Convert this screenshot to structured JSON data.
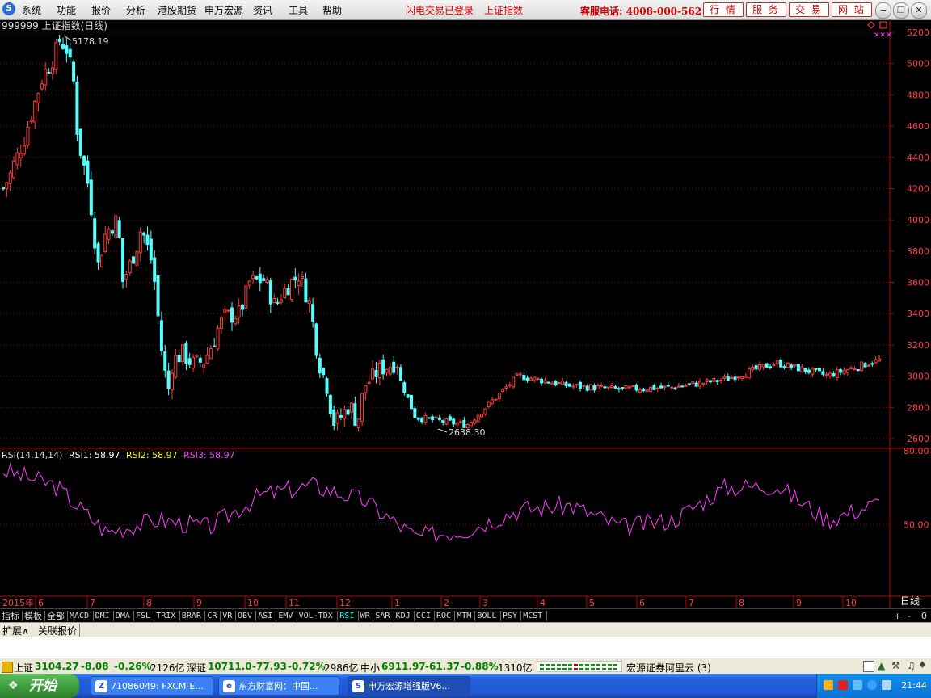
{
  "menu": {
    "items": [
      "系统",
      "功能",
      "报价",
      "分析",
      "港股期货",
      "申万宏源",
      "资讯",
      "工具",
      "帮助"
    ],
    "status_login": "闪电交易已登录",
    "status_index": "上证指数",
    "hotline": "客服电话: 4008-000-562",
    "right_buttons": [
      "行 情",
      "服 务",
      "交 易",
      "网 站"
    ]
  },
  "chart_data": [
    {
      "type": "candlestick",
      "title": "999999 上证指数(日线)",
      "max_label": "5178.19",
      "min_label": "2638.30",
      "ylim": [
        2560,
        5260
      ],
      "y_ticks": [
        "5200",
        "5000",
        "4800",
        "4600",
        "4400",
        "4200",
        "4000",
        "3800",
        "3600",
        "3400",
        "3200",
        "3000",
        "2800",
        "2600"
      ],
      "x_labels": [
        "2015年",
        "6",
        "7",
        "8",
        "9",
        "10",
        "11",
        "12",
        "1",
        "2",
        "3",
        "4",
        "5",
        "6",
        "7",
        "8",
        "9",
        "10"
      ],
      "period_label": "日线",
      "colors": {
        "up": "#ff3c3c",
        "down": "#54ffff"
      },
      "closes_monthly_approx": [
        {
          "month": "2015-05",
          "close": 4612
        },
        {
          "month": "2015-06",
          "close": 4277
        },
        {
          "month": "2015-07",
          "close": 3663
        },
        {
          "month": "2015-08",
          "close": 3206
        },
        {
          "month": "2015-09",
          "close": 3053
        },
        {
          "month": "2015-10",
          "close": 3382
        },
        {
          "month": "2015-11",
          "close": 3445
        },
        {
          "month": "2015-12",
          "close": 3539
        },
        {
          "month": "2016-01",
          "close": 2737
        },
        {
          "month": "2016-02",
          "close": 2688
        },
        {
          "month": "2016-03",
          "close": 3003
        },
        {
          "month": "2016-04",
          "close": 2938
        },
        {
          "month": "2016-05",
          "close": 2916
        },
        {
          "month": "2016-06",
          "close": 2929
        },
        {
          "month": "2016-07",
          "close": 2979
        },
        {
          "month": "2016-08",
          "close": 3085
        },
        {
          "month": "2016-09",
          "close": 3004
        },
        {
          "month": "2016-10",
          "close": 3104
        }
      ]
    },
    {
      "type": "line",
      "title": "RSI(14,14,14)",
      "series": [
        {
          "name": "RSI1",
          "value": "58.97",
          "color": "#ffffff"
        },
        {
          "name": "RSI2",
          "value": "58.97",
          "color": "#ffff00"
        },
        {
          "name": "RSI3",
          "value": "58.97",
          "color": "#ff40ff"
        }
      ],
      "ylim": [
        42,
        80
      ],
      "y_ticks": [
        "80.00",
        "50.00"
      ],
      "values_monthly_approx": [
        {
          "month": "2015-05",
          "value": 72
        },
        {
          "month": "2015-06",
          "value": 66
        },
        {
          "month": "2015-07",
          "value": 47
        },
        {
          "month": "2015-08",
          "value": 52
        },
        {
          "month": "2015-09",
          "value": 49
        },
        {
          "month": "2015-10",
          "value": 62
        },
        {
          "month": "2015-11",
          "value": 66
        },
        {
          "month": "2015-12",
          "value": 60
        },
        {
          "month": "2016-01",
          "value": 45
        },
        {
          "month": "2016-02",
          "value": 48
        },
        {
          "month": "2016-03",
          "value": 56
        },
        {
          "month": "2016-04",
          "value": 58
        },
        {
          "month": "2016-05",
          "value": 49
        },
        {
          "month": "2016-06",
          "value": 52
        },
        {
          "month": "2016-07",
          "value": 65
        },
        {
          "month": "2016-08",
          "value": 66
        },
        {
          "month": "2016-09",
          "value": 52
        },
        {
          "month": "2016-10",
          "value": 59
        }
      ]
    }
  ],
  "toolbar": {
    "tabs": [
      "指标",
      "模板",
      "全部",
      "MACD",
      "DMI",
      "DMA",
      "FSL",
      "TRIX",
      "BRAR",
      "CR",
      "VR",
      "OBV",
      "ASI",
      "EMV",
      "VOL-TDX",
      "RSI",
      "WR",
      "SAR",
      "KDJ",
      "CCI",
      "ROC",
      "MTM",
      "BOLL",
      "PSY",
      "MCST"
    ],
    "selected": "RSI",
    "controls": [
      "+",
      "-",
      "0"
    ]
  },
  "lower_tabs": [
    "扩展∧",
    "关联报价"
  ],
  "quotes": {
    "sh_label": "上证",
    "sh_val": "3104.27",
    "sh_chg": "-8.08",
    "sh_pct": "-0.26%",
    "sh_amt": "2126亿",
    "sz_label": "深证",
    "sz_val": "10711.0",
    "sz_chg": "-77.93",
    "sz_pct": "-0.72%",
    "sz_amt": "2986亿",
    "zx_label": "中小",
    "zx_val": "6911.97",
    "zx_chg": "-61.37",
    "zx_pct": "-0.88%",
    "zx_amt": "1310亿",
    "broker": "宏源证券阿里云 (3)"
  },
  "taskbar": {
    "start": "开始",
    "tasks": [
      "71086049: FXCM-E...",
      "东方财富网：中国...",
      "申万宏源增强版V6..."
    ],
    "clock": "21:44"
  }
}
